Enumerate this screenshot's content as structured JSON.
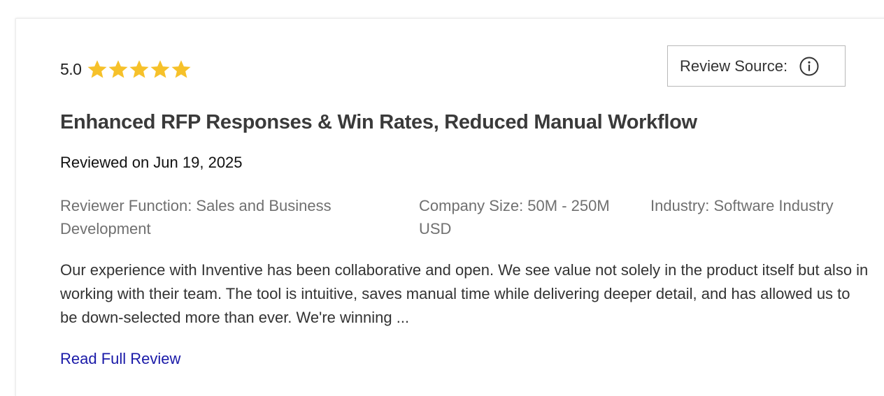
{
  "review": {
    "rating_value": "5.0",
    "rating_stars": 5,
    "star_color": "#f6c12a",
    "source_label": "Review Source:",
    "title": "Enhanced RFP Responses & Win Rates, Reduced Manual Workflow",
    "reviewed_on": "Reviewed on Jun 19, 2025",
    "reviewer_function": "Reviewer Function: Sales and Business Development",
    "company_size": "Company Size: 50M - 250M USD",
    "industry": "Industry: Software Industry",
    "body": "Our experience with Inventive has been collaborative and open. We see value not solely in the product itself but also in working with their team. The tool is intuitive, saves manual time while delivering deeper detail, and has allowed us to be down-selected more than ever. We're winning ...",
    "read_more_label": "Read Full Review",
    "link_color": "#1a1aa8"
  }
}
